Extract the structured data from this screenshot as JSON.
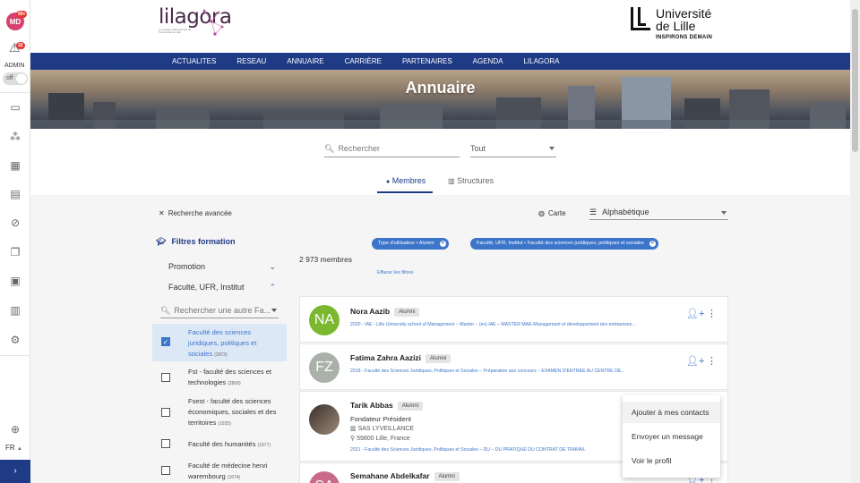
{
  "rail": {
    "avatar_initials": "MD",
    "avatar_badge": "99+",
    "warn_badge": "32",
    "admin_label": "ADMIN",
    "toggle_label": "off",
    "lang_label": "FR",
    "lang_caret": "▲",
    "expand_label": "›"
  },
  "header": {
    "logo_name": "lilagora",
    "logo_tagline": "Le réseau professionnel de l'Université de Lille",
    "uni_line1": "Université",
    "uni_line2": "de Lille",
    "uni_line3": "INSPIRONS DEMAIN"
  },
  "nav": {
    "items": [
      "ACTUALITES",
      "RESEAU",
      "ANNUAIRE",
      "CARRIÈRE",
      "PARTENAIRES",
      "AGENDA",
      "LILAGORA"
    ]
  },
  "banner": {
    "title": "Annuaire"
  },
  "search": {
    "placeholder": "Rechercher",
    "type_value": "Tout"
  },
  "tabs": {
    "members": "Membres",
    "structures": "Structures"
  },
  "toolbar": {
    "advanced_search": "Recherche avancée",
    "map_label": "Carte",
    "sort_value": "Alphabétique"
  },
  "filters": {
    "title": "Filtres formation",
    "facet_promotion": "Promotion",
    "facet_faculty": "Faculté, UFR, Institut",
    "facet_search_placeholder": "Rechercher une autre Fa...",
    "options": [
      {
        "label": "Faculté des sciences juridiques, politiques et sociales",
        "count": "(2973)"
      },
      {
        "label": "Fst - faculté des sciences et technologies",
        "count": "(2869)"
      },
      {
        "label": "Fsest - faculté des sciences économiques, sociales et des territoires",
        "count": "(1925)"
      },
      {
        "label": "Faculté des humanités",
        "count": "(1877)"
      },
      {
        "label": "Faculté de médecine henri warembourg",
        "count": "(1674)"
      }
    ]
  },
  "results": {
    "chip1": "Type d'utilisateur • Alumni",
    "chip2": "Faculté, UFR, Institut • Faculté des sciences juridiques, politiques et sociales",
    "count": "2 973 membres",
    "clear": "Effacer les filtres",
    "members": [
      {
        "initials": "NA",
        "name": "Nora Aazib",
        "badge": "Alumni",
        "line": "2020 - IAE - Lille University school of Management – Master – (ex) IAE – MASTER MAE-Management et développement des entreprises..."
      },
      {
        "initials": "FZ",
        "name": "Fatima Zahra Aazizi",
        "badge": "Alumni",
        "line": "2018 - Faculté des Sciences Juridiques, Politiques et Sociales – Préparation aux concours – EXAMEN D'ENTREE AU CENTRE DE..."
      },
      {
        "initials": "",
        "name": "Tarik Abbas",
        "badge": "Alumni",
        "job": "Fondateur Président",
        "company": "SAS LYVEILLANCE",
        "location": "59800 Lille, France",
        "line": "2021 - Faculté des Sciences Juridiques, Politiques et Sociales – DU – DU PRATIQUE DU CONTRAT DE TRAVAIL"
      },
      {
        "initials": "SA",
        "name": "Semahane Abdelkafar",
        "badge": "Alumni"
      }
    ]
  },
  "menu": {
    "add": "Ajouter à mes contacts",
    "message": "Envoyer un message",
    "profile": "Voir le profil"
  },
  "colors": {
    "brand_navy": "#1f3b86",
    "accent_blue": "#3c75c9",
    "avatar_green": "#7cb82f",
    "avatar_gray": "#a9b1a8"
  }
}
